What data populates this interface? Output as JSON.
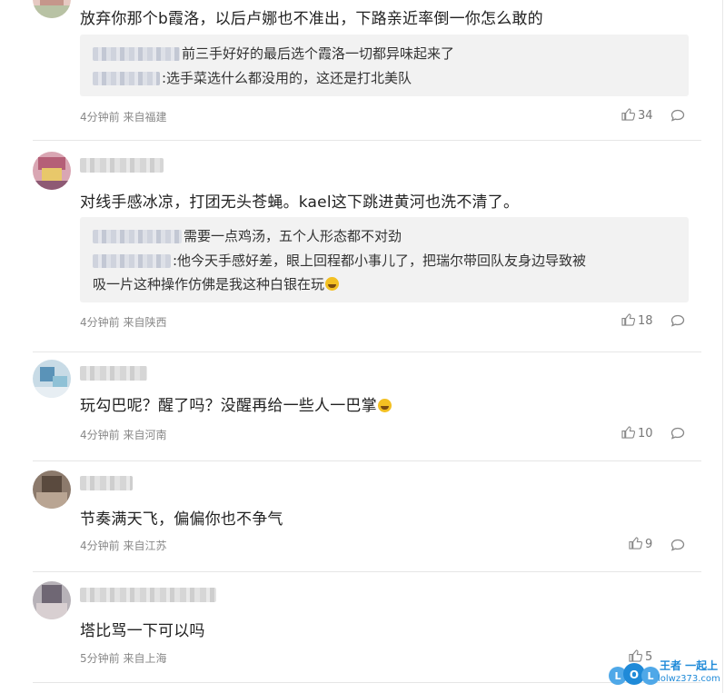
{
  "comments": [
    {
      "text": "放弃你那个b霞洛，以后卢娜也不准出，下路亲近率倒一你怎么敢的",
      "quotes": [
        {
          "text": "前三手好好的最后选个霞洛一切都异味起来了"
        },
        {
          "text": ":选手菜选什么都没用的，这还是打北美队"
        }
      ],
      "meta": "4分钟前 来自福建",
      "likes": "34"
    },
    {
      "text": "对线手感冰凉，打团无头苍蝇。kael这下跳进黄河也洗不清了。",
      "quotes": [
        {
          "text": "需要一点鸡汤，五个人形态都不对劲"
        },
        {
          "text": ":他今天手感好差，眼上回程都小事儿了，把瑞尔带回队友身边导致被"
        },
        {
          "text": "吸一片这种操作仿佛是我这种白银在玩"
        }
      ],
      "meta": "4分钟前 来自陕西",
      "likes": "18"
    },
    {
      "text": "玩勾巴呢？醒了吗？没醒再给一些人一巴掌",
      "meta": "4分钟前 来自河南",
      "likes": "10"
    },
    {
      "text": "节奏满天飞，偏偏你也不争气",
      "meta": "4分钟前 来自江苏",
      "likes": "9"
    },
    {
      "text": "塔比骂一下可以吗",
      "meta": "5分钟前 来自上海",
      "likes": "5"
    }
  ],
  "watermark": {
    "brand": "王者 一起上",
    "url": "lolwz373.com",
    "logo_text": "LOL"
  },
  "icons": {
    "like": "thumbs-up-icon",
    "reply": "comment-bubble-icon",
    "emoji": "laughing-emoji-icon"
  },
  "colors": {
    "quote_bg": "#f2f2f2",
    "meta_text": "#888888",
    "watermark_blue": "#1f8ad8"
  }
}
